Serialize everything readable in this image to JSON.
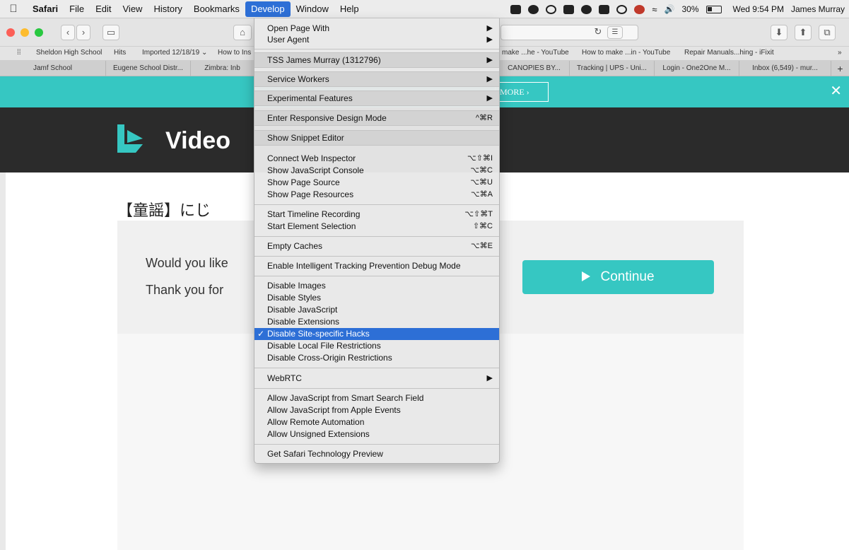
{
  "menubar": {
    "apple": "",
    "items": [
      "Safari",
      "File",
      "Edit",
      "View",
      "History",
      "Bookmarks",
      "Develop",
      "Window",
      "Help"
    ],
    "battery_pct": "30%",
    "clock": "Wed 9:54 PM",
    "user": "James Murray"
  },
  "toolbar": {
    "back": "‹",
    "forward": "›",
    "sidebar": "▭",
    "home": "⌂",
    "reload": "↻",
    "reader": "☰",
    "download": "⬇",
    "share": "⬆",
    "tabs": "⧉"
  },
  "favorites": {
    "grid": "⁞⁞",
    "items": [
      "Sheldon High School",
      "Hits",
      "Imported 12/18/19 ⌄",
      "How to Ins",
      "make ...he - YouTube",
      "How to make ...in - YouTube",
      "Repair Manuals...hing - iFixit",
      "»"
    ]
  },
  "tabs": {
    "items": [
      "Jamf School",
      "Eugene School Distr...",
      "Zimbra: Inb",
      "CANOPIES BY...",
      "Tracking | UPS - Uni...",
      "Login - One2One M...",
      "Inbox (6,549) - mur..."
    ],
    "new_tab": "+"
  },
  "page": {
    "banner_button": "MORE ›",
    "banner_close": "✕",
    "logo_text": "Video",
    "song_title": "【童謡】にじ",
    "prompt_line1": "Would you like",
    "prompt_line2": "Thank you for",
    "continue_label": "Continue"
  },
  "develop_menu": {
    "open_page_with": "Open Page With",
    "user_agent": "User Agent",
    "device": "TSS James Murray (1312796)",
    "service_workers": "Service Workers",
    "experimental": "Experimental Features",
    "responsive": "Enter Responsive Design Mode",
    "responsive_sc": "^⌘R",
    "snippet": "Show Snippet Editor",
    "connect_inspector": "Connect Web Inspector",
    "connect_inspector_sc": "⌥⇧⌘I",
    "js_console": "Show JavaScript Console",
    "js_console_sc": "⌥⌘C",
    "page_source": "Show Page Source",
    "page_source_sc": "⌥⌘U",
    "page_resources": "Show Page Resources",
    "page_resources_sc": "⌥⌘A",
    "timeline": "Start Timeline Recording",
    "timeline_sc": "⌥⇧⌘T",
    "element_selection": "Start Element Selection",
    "element_selection_sc": "⇧⌘C",
    "empty_caches": "Empty Caches",
    "empty_caches_sc": "⌥⌘E",
    "itp_debug": "Enable Intelligent Tracking Prevention Debug Mode",
    "disable_images": "Disable Images",
    "disable_styles": "Disable Styles",
    "disable_js": "Disable JavaScript",
    "disable_extensions": "Disable Extensions",
    "disable_hacks": "Disable Site-specific Hacks",
    "disable_local": "Disable Local File Restrictions",
    "disable_cors": "Disable Cross-Origin Restrictions",
    "webrtc": "WebRTC",
    "allow_js_search": "Allow JavaScript from Smart Search Field",
    "allow_js_apple": "Allow JavaScript from Apple Events",
    "allow_remote": "Allow Remote Automation",
    "allow_unsigned": "Allow Unsigned Extensions",
    "tech_preview": "Get Safari Technology Preview",
    "arrow": "▶",
    "check": "✓"
  }
}
